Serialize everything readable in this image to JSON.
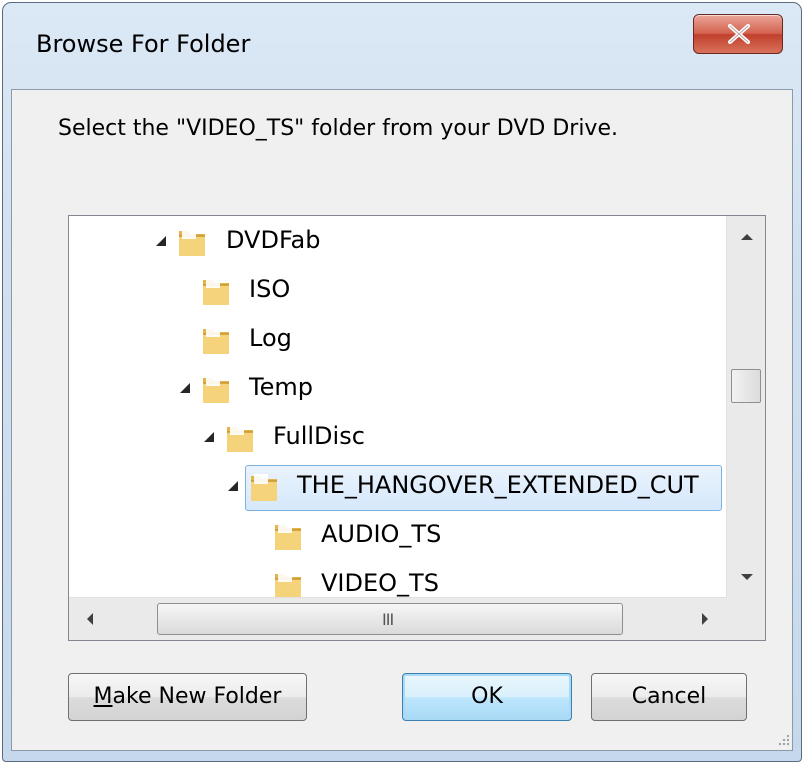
{
  "window": {
    "title": "Browse For Folder",
    "close_label": "X"
  },
  "prompt": "Select the \"VIDEO_TS\" folder from your DVD Drive.",
  "tree": {
    "items": [
      {
        "label": "DVDFab",
        "expanded": true,
        "level": 0
      },
      {
        "label": "ISO",
        "expanded": false,
        "level": 1
      },
      {
        "label": "Log",
        "expanded": false,
        "level": 1
      },
      {
        "label": "Temp",
        "expanded": true,
        "level": 1
      },
      {
        "label": "FullDisc",
        "expanded": true,
        "level": 2
      },
      {
        "label": "THE_HANGOVER_EXTENDED_CUT",
        "expanded": true,
        "level": 3,
        "selected": true
      },
      {
        "label": "AUDIO_TS",
        "expanded": false,
        "level": 4
      },
      {
        "label": "VIDEO_TS",
        "expanded": false,
        "level": 4
      }
    ],
    "hscroll_grip": "III"
  },
  "buttons": {
    "make_new_folder_first": "M",
    "make_new_folder_rest": "ake New Folder",
    "ok": "OK",
    "cancel": "Cancel"
  },
  "colors": {
    "selection_border": "#7fb1e3",
    "close_red": "#c0402d",
    "default_button_border": "#3c7fb1"
  }
}
